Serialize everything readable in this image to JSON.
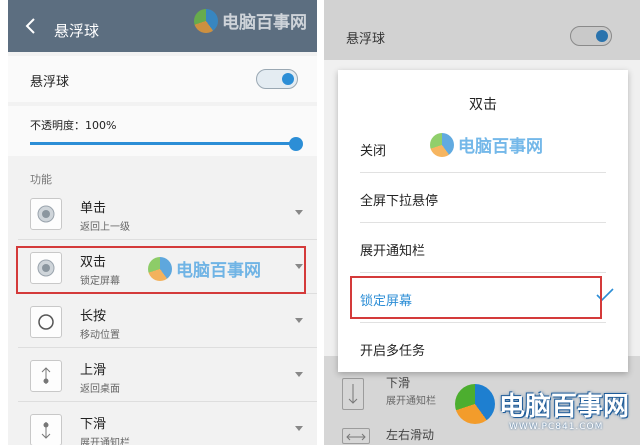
{
  "left": {
    "header": {
      "title": "悬浮球"
    },
    "float_ball": {
      "label": "悬浮球",
      "enabled": true
    },
    "opacity": {
      "label": "不透明度：100%",
      "value_percent": 100
    },
    "section_label": "功能",
    "functions": [
      {
        "title": "单击",
        "subtitle": "返回上一级",
        "icon": "dot-circle-icon"
      },
      {
        "title": "双击",
        "subtitle": "锁定屏幕",
        "icon": "dot-circle-icon"
      },
      {
        "title": "长按",
        "subtitle": "移动位置",
        "icon": "circle-icon"
      },
      {
        "title": "上滑",
        "subtitle": "返回桌面",
        "icon": "swipe-up-icon"
      },
      {
        "title": "下滑",
        "subtitle": "展开通知栏",
        "icon": "swipe-down-icon"
      }
    ]
  },
  "right": {
    "header": {
      "title": "悬浮球",
      "enabled": true
    },
    "dialog": {
      "title": "双击",
      "options": [
        "关闭",
        "全屏下拉悬停",
        "展开通知栏",
        "锁定屏幕",
        "开启多任务"
      ],
      "selected_index": 3
    },
    "background_items": [
      {
        "title": "下滑",
        "subtitle": "展开通知栏"
      },
      {
        "title": "左右滑动"
      }
    ]
  },
  "watermark": {
    "brand": "电脑百事网",
    "url": "WWW.PC841.COM"
  },
  "colors": {
    "accent": "#2c8ed6",
    "highlight": "#d43a3a",
    "header": "#5c6e80"
  }
}
